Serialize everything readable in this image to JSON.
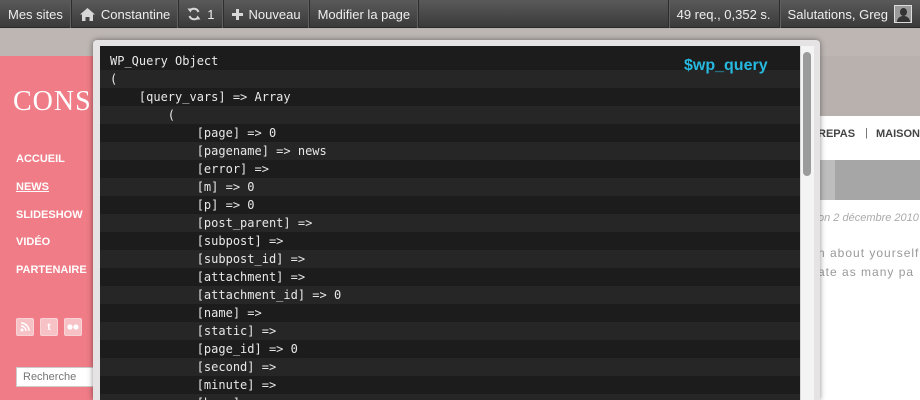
{
  "adminbar": {
    "my_sites": "Mes sites",
    "site_name": "Constantine",
    "updates_count": "1",
    "new_label": "Nouveau",
    "edit_page": "Modifier la page",
    "queries": "49 req., 0,352 s.",
    "greeting": "Salutations, Greg"
  },
  "site": {
    "logo": "CONS",
    "nav": [
      "ACCUEIL",
      "NEWS",
      "SLIDESHOW",
      "VIDÉO",
      "PARTENAIRE"
    ],
    "social": [
      "rss",
      "twitter",
      "flickr"
    ],
    "search_placeholder": "Recherche",
    "right_nav": [
      "REPAS",
      "MAISON"
    ],
    "right_sep": "|",
    "right_date": "on 2 décembre 2010",
    "right_text": [
      "n about yourself",
      "ate as many pa"
    ]
  },
  "debug": {
    "title": "$wp_query",
    "lines": [
      "WP_Query Object",
      "(",
      "    [query_vars] => Array",
      "        (",
      "            [page] => 0",
      "            [pagename] => news",
      "            [error] =>",
      "            [m] => 0",
      "            [p] => 0",
      "            [post_parent] =>",
      "            [subpost] =>",
      "            [subpost_id] =>",
      "            [attachment] =>",
      "            [attachment_id] => 0",
      "            [name] =>",
      "            [static] =>",
      "            [page_id] => 0",
      "            [second] =>",
      "            [minute] =>",
      "            [hour] =>"
    ]
  }
}
